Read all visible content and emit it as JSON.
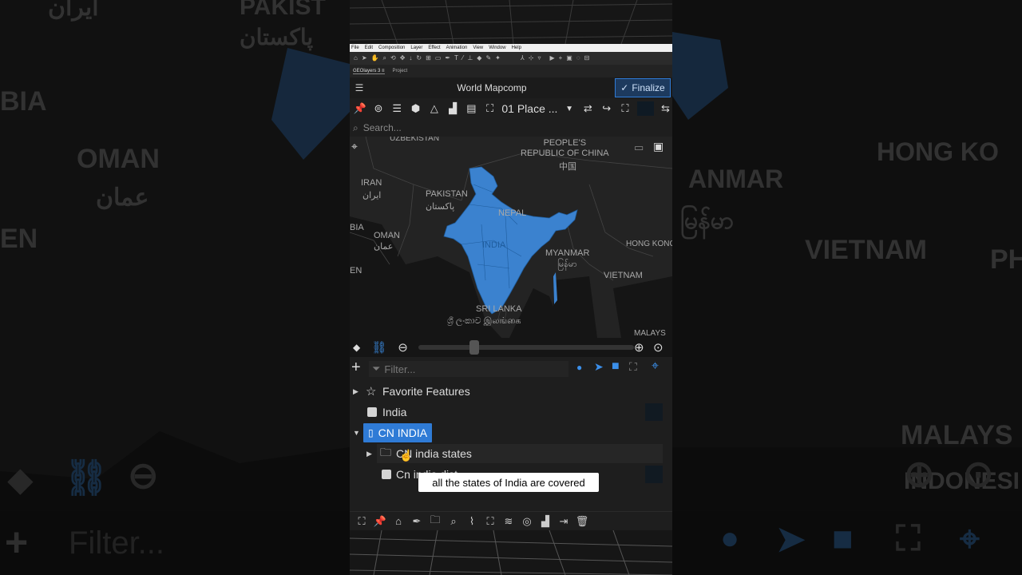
{
  "background_left": {
    "labels": [
      "ایران",
      "PAKIST",
      "پاکستان",
      "BIA",
      "OMAN",
      "عمان",
      "EN"
    ]
  },
  "background_right": {
    "labels": [
      "HONG KO",
      "ANMAR",
      "မြန်မာ",
      "VIETNAM",
      "PH",
      "MALAYS",
      "INDONESI"
    ]
  },
  "background_bottom": {
    "filter_placeholder": "Filter..."
  },
  "menubar": {
    "items": [
      "File",
      "Edit",
      "Composition",
      "Layer",
      "Effect",
      "Animation",
      "View",
      "Window",
      "Help"
    ]
  },
  "tabs": {
    "geolayers": "GEOlayers 3",
    "menu": "≡",
    "project": "Project"
  },
  "header": {
    "title": "World Mapcomp",
    "finalize_label": "Finalize"
  },
  "toolbar": {
    "place_label": "01 Place ..."
  },
  "search": {
    "placeholder": "Search..."
  },
  "map": {
    "labels": {
      "uzbekistan": "UZBEKISTAN",
      "china": "PEOPLE'S\nREPUBLIC OF CHINA",
      "china_native": "中国",
      "iran": "IRAN",
      "iran_native": "ایران",
      "pakistan": "PAKISTAN",
      "pakistan_native": "پاکستان",
      "nepal": "NEPAL",
      "india": "INDIA",
      "arabia": "BIA",
      "oman": "OMAN",
      "oman_native": "عمان",
      "yemen": "EN",
      "hongkong": "HONG KONG",
      "myanmar": "MYANMAR",
      "myanmar_native": "မြန်မာ",
      "vietnam": "VIETNAM",
      "srilanka": "SRI LANKA",
      "srilanka_native": "ශ්‍රී ලංකාව இலங்கை",
      "malaysia": "MALAYS"
    },
    "highlight_color": "#3b82cf"
  },
  "filter": {
    "placeholder": "Filter..."
  },
  "tree": {
    "favorite": "Favorite Features",
    "india": "India",
    "cn_india": "CN INDIA",
    "cn_states": "CN india states",
    "cn_dist": "Cn india dist"
  },
  "subtitle": {
    "text": "all the states of India are covered"
  },
  "colors": {
    "accent": "#2f7bd6",
    "panel_bg": "#1e1e1e",
    "map_bg": "#151515"
  }
}
